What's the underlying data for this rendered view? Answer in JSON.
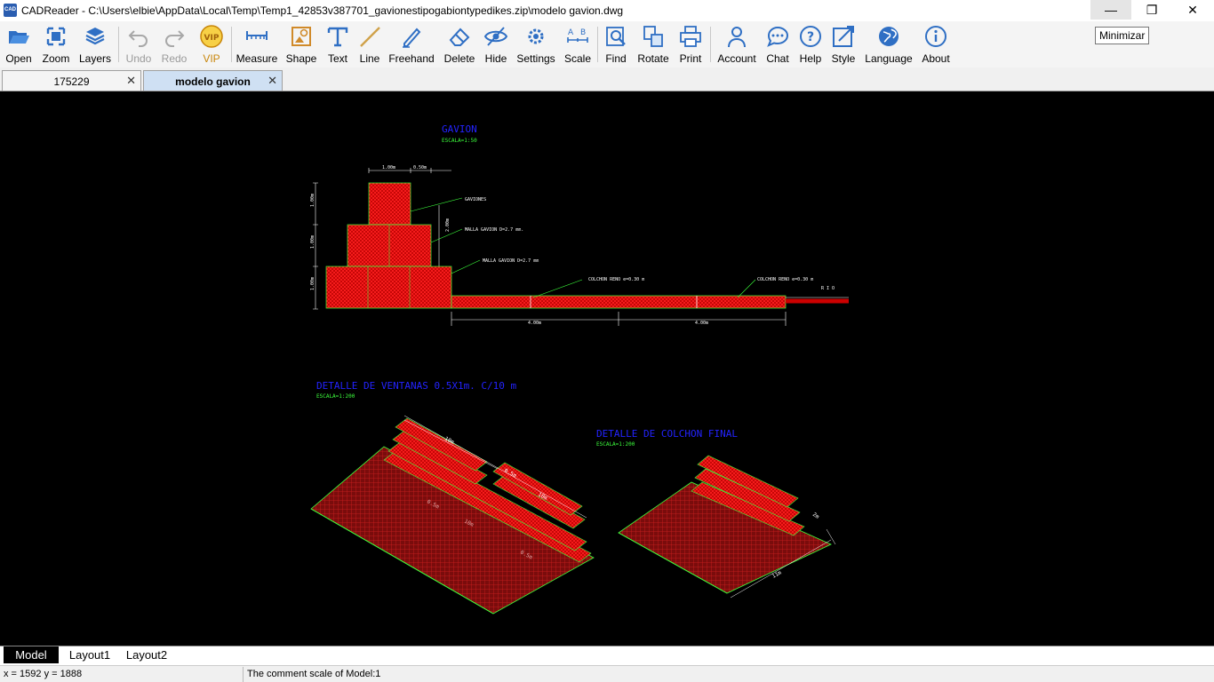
{
  "window": {
    "title": "CADReader - C:\\Users\\elbie\\AppData\\Local\\Temp\\Temp1_42853v387701_gavionestipogabiontypedikes.zip\\modelo gavion.dwg",
    "logo_text": "CAD",
    "minimize": "—",
    "maximize": "❐",
    "close": "✕",
    "tooltip": "Minimizar"
  },
  "toolbar": {
    "open": "Open",
    "zoom": "Zoom",
    "layers": "Layers",
    "undo": "Undo",
    "redo": "Redo",
    "vip": "VIP",
    "measure": "Measure",
    "shape": "Shape",
    "text": "Text",
    "line": "Line",
    "freehand": "Freehand",
    "delete": "Delete",
    "hide": "Hide",
    "settings": "Settings",
    "scale": "Scale",
    "find": "Find",
    "rotate": "Rotate",
    "print": "Print",
    "account": "Account",
    "chat": "Chat",
    "help": "Help",
    "style": "Style",
    "language": "Language",
    "about": "About"
  },
  "tabs": [
    {
      "label": "175229",
      "close": "✕"
    },
    {
      "label": "modelo gavion",
      "close": "✕"
    }
  ],
  "drawing": {
    "title1": "GAVION",
    "scale1": "ESCALA=1:50",
    "dim_top1": "1.00m",
    "dim_top2": "0.50m",
    "dim_v1": "1.00m",
    "dim_v2": "1.00m",
    "dim_v3": "1.00m",
    "dim_v4": "2.00m",
    "label_gaviones": "GAVIONES",
    "label_malla1": "MALLA GAVION D=2.7 mm.",
    "label_malla2": "MALLA GAVION D=2.7 mm",
    "label_colchon1": "COLCHON RENO e=0.30 m",
    "label_colchon2": "COLCHON RENO e=0.30 m",
    "label_rio": "R I O",
    "dim_bottom1": "4.00m",
    "dim_bottom2": "4.00m",
    "title2": "DETALLE DE VENTANAS 0.5X1m. C/10 m",
    "scale2": "ESCALA=1:200",
    "title3": "DETALLE DE COLCHON FINAL",
    "scale3": "ESCALA=1:200",
    "iso_dim1": "10m",
    "iso_dim2": "0.5m",
    "iso_dim3": "10m",
    "iso_dim4": "0.5m",
    "iso_dim5": "10m",
    "iso_dim6": "0.5m",
    "iso2_dim1": "2m",
    "iso2_dim2": "11m"
  },
  "layouts": [
    "Model",
    "Layout1",
    "Layout2"
  ],
  "status": {
    "coords": "x = 1592  y = 1888",
    "scale": "The comment scale of Model:1"
  },
  "colors": {
    "cad_blue": "#2323ff",
    "cad_green": "#3cff3c",
    "cad_red": "#e00000",
    "cad_white": "#ffffff"
  }
}
